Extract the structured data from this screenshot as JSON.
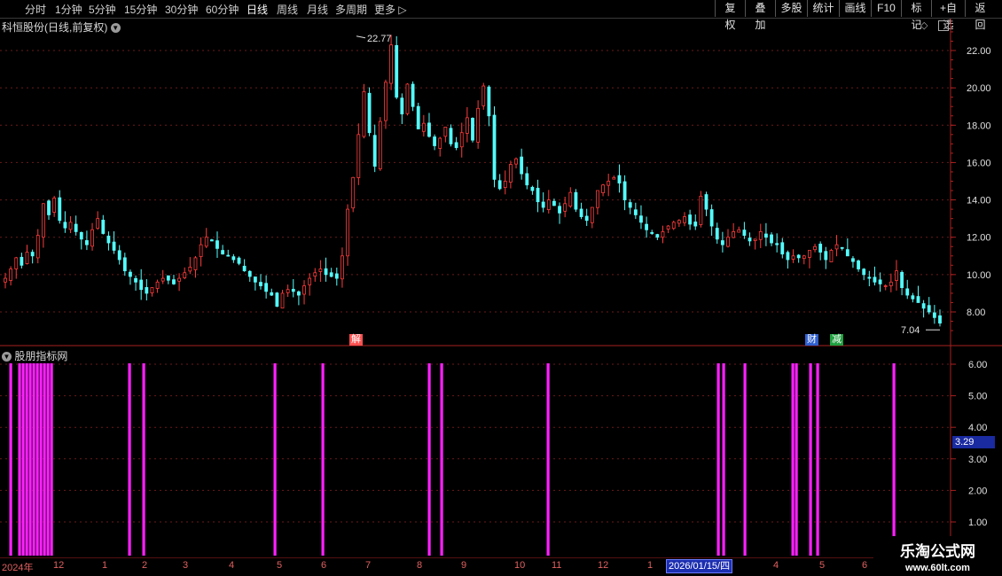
{
  "toolbar": {
    "periods": [
      {
        "label": "分时"
      },
      {
        "label": "1分钟"
      },
      {
        "label": "5分钟"
      },
      {
        "label": "15分钟"
      },
      {
        "label": "30分钟"
      },
      {
        "label": "60分钟"
      },
      {
        "label": "日线",
        "active": true
      },
      {
        "label": "周线"
      },
      {
        "label": "月线"
      },
      {
        "label": "多周期"
      },
      {
        "label": "更多"
      }
    ],
    "right_buttons": [
      "复权",
      "叠加",
      "多股",
      "统计",
      "画线",
      "F10",
      "标记",
      "+自选",
      "返回"
    ]
  },
  "chart": {
    "title": "科恒股份(日线,前复权)",
    "high_label": "22.77",
    "low_label": "7.04",
    "y_ticks": [
      "22.00",
      "20.00",
      "18.00",
      "16.00",
      "14.00",
      "12.00",
      "10.00",
      "8.00"
    ],
    "tags": [
      {
        "label": "解",
        "color": "#ffffff",
        "bg": "#ff5050"
      },
      {
        "label": "财",
        "color": "#ffffff",
        "bg": "#3060d0"
      },
      {
        "label": "减",
        "color": "#ffffff",
        "bg": "#20a040"
      }
    ]
  },
  "indicator": {
    "title": "股朋指标网",
    "y_ticks": [
      "6.00",
      "5.00",
      "4.00",
      "3.00",
      "2.00",
      "1.00"
    ],
    "current_value": "3.29",
    "bar_color": "#ff20ff"
  },
  "time_axis": {
    "labels": [
      "2024年",
      "12",
      "1",
      "2",
      "3",
      "4",
      "5",
      "6",
      "7",
      "8",
      "9",
      "10",
      "11",
      "12",
      "1",
      "4",
      "5",
      "6"
    ],
    "current_date": "2026/01/15/四"
  },
  "watermark": {
    "title": "乐淘公式网",
    "url": "www.60lt.com"
  },
  "colors": {
    "up": "#ff3c3c",
    "down": "#54ffff",
    "grid": "#6a1a1a",
    "axis": "#aa2020"
  },
  "chart_data": {
    "type": "candlestick",
    "ohlc_close_series": [
      9.8,
      10.3,
      10.9,
      10.5,
      11.2,
      11.0,
      12.1,
      13.8,
      13.2,
      14.1,
      12.9,
      12.5,
      12.8,
      12.3,
      11.9,
      11.6,
      12.4,
      13.0,
      12.2,
      11.7,
      11.3,
      10.8,
      10.2,
      9.9,
      9.6,
      9.2,
      9.0,
      9.3,
      9.6,
      9.8,
      9.7,
      9.5,
      9.8,
      10.1,
      10.4,
      10.9,
      11.6,
      12.0,
      11.8,
      11.4,
      11.1,
      11.0,
      10.8,
      10.6,
      10.2,
      9.9,
      9.6,
      9.4,
      9.1,
      8.9,
      8.3,
      9.0,
      9.2,
      9.1,
      8.9,
      9.4,
      9.8,
      10.1,
      10.3,
      10.0,
      9.9,
      9.8,
      11.0,
      13.5,
      15.2,
      17.5,
      19.8,
      17.6,
      15.8,
      18.2,
      20.3,
      22.3,
      19.5,
      18.6,
      20.2,
      19.0,
      17.8,
      18.1,
      17.4,
      16.9,
      17.3,
      17.9,
      17.0,
      16.8,
      17.6,
      18.4,
      17.2,
      18.9,
      20.1,
      18.5,
      15.1,
      14.6,
      15.0,
      15.9,
      16.2,
      15.4,
      14.8,
      14.5,
      13.9,
      13.6,
      14.0,
      13.7,
      13.3,
      13.8,
      14.4,
      13.5,
      13.1,
      12.9,
      13.6,
      14.5,
      14.8,
      15.0,
      15.2,
      14.9,
      14.0,
      13.6,
      13.2,
      12.8,
      12.4,
      12.2,
      12.0,
      12.3,
      12.6,
      12.8,
      12.9,
      13.1,
      12.7,
      12.6,
      14.2,
      13.5,
      12.6,
      11.9,
      11.6,
      12.0,
      12.3,
      12.4,
      12.1,
      11.8,
      11.9,
      12.3,
      12.0,
      11.7,
      11.6,
      11.1,
      10.8,
      11.0,
      10.9,
      11.0,
      11.3,
      11.5,
      11.2,
      10.8,
      11.3,
      11.6,
      11.4,
      11.0,
      10.7,
      10.3,
      10.0,
      9.8,
      9.6,
      9.5,
      9.4,
      9.6,
      10.2,
      9.3,
      8.9,
      8.7,
      8.5,
      8.2,
      8.0,
      7.7,
      7.4
    ],
    "indicator_bar_positions": [
      12,
      22,
      26,
      30,
      34,
      38,
      42,
      46,
      50,
      54,
      58,
      146,
      162,
      310,
      364,
      484,
      498,
      618,
      810,
      816,
      840,
      894,
      898,
      914,
      922,
      1008
    ],
    "high": 22.77,
    "low": 7.04,
    "ylim": [
      7,
      23
    ],
    "indicator_ylim": [
      0,
      6.5
    ],
    "indicator_current": 3.29
  }
}
